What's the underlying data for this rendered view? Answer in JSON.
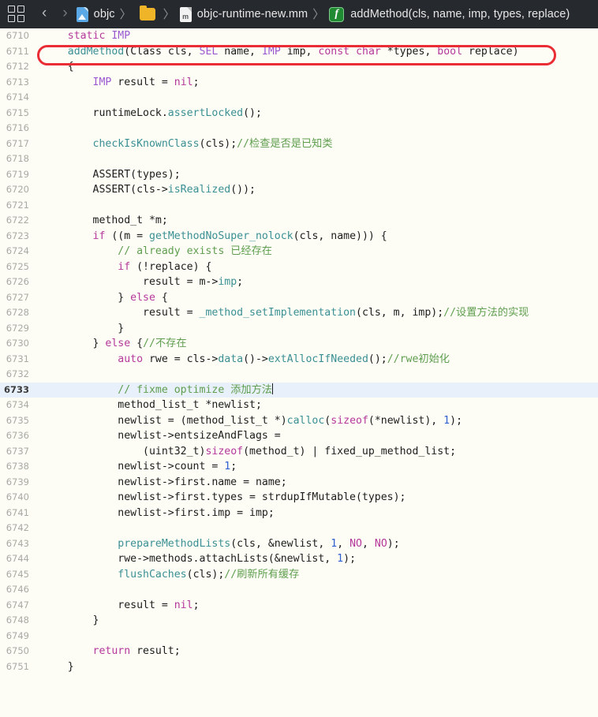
{
  "breadcrumb": {
    "grid_icon": "grid-tiles-icon",
    "back_label": "‹",
    "forward_label": "›",
    "separator": "〉",
    "items": [
      {
        "icon": "xcode-project-icon",
        "label": "objc"
      },
      {
        "icon": "folder-icon",
        "label": ""
      },
      {
        "icon": "objc-source-file-icon",
        "icon_text": "m",
        "label": "objc-runtime-new.mm"
      },
      {
        "icon": "function-symbol-icon",
        "icon_text": "f",
        "label": "addMethod(cls, name, imp, types, replace)"
      }
    ]
  },
  "editor": {
    "current_line": 6733,
    "annotated_line": 6711,
    "annotation_color": "#ea2d35",
    "current_line_highlight": "#e8f0fb",
    "background": "#fdfdf6",
    "lines": [
      {
        "n": 6710,
        "tokens": [
          {
            "t": "    ",
            "c": "pl"
          },
          {
            "t": "static",
            "c": "kw"
          },
          {
            "t": " ",
            "c": "pl"
          },
          {
            "t": "IMP",
            "c": "typ"
          }
        ]
      },
      {
        "n": 6711,
        "tokens": [
          {
            "t": "    ",
            "c": "pl"
          },
          {
            "t": "addMethod",
            "c": "fn"
          },
          {
            "t": "(",
            "c": "pl"
          },
          {
            "t": "Class",
            "c": "pl"
          },
          {
            "t": " cls, ",
            "c": "pl"
          },
          {
            "t": "SEL",
            "c": "typ"
          },
          {
            "t": " name, ",
            "c": "pl"
          },
          {
            "t": "IMP",
            "c": "typ"
          },
          {
            "t": " imp, ",
            "c": "pl"
          },
          {
            "t": "const",
            "c": "kw"
          },
          {
            "t": " ",
            "c": "pl"
          },
          {
            "t": "char",
            "c": "kw"
          },
          {
            "t": " *types, ",
            "c": "pl"
          },
          {
            "t": "bool",
            "c": "kw"
          },
          {
            "t": " replace)",
            "c": "pl"
          }
        ]
      },
      {
        "n": 6712,
        "tokens": [
          {
            "t": "    {",
            "c": "pl"
          }
        ]
      },
      {
        "n": 6713,
        "tokens": [
          {
            "t": "        ",
            "c": "pl"
          },
          {
            "t": "IMP",
            "c": "typ"
          },
          {
            "t": " result = ",
            "c": "pl"
          },
          {
            "t": "nil",
            "c": "kw"
          },
          {
            "t": ";",
            "c": "pl"
          }
        ]
      },
      {
        "n": 6714,
        "tokens": []
      },
      {
        "n": 6715,
        "tokens": [
          {
            "t": "        runtimeLock.",
            "c": "pl"
          },
          {
            "t": "assertLocked",
            "c": "fn"
          },
          {
            "t": "();",
            "c": "pl"
          }
        ]
      },
      {
        "n": 6716,
        "tokens": []
      },
      {
        "n": 6717,
        "tokens": [
          {
            "t": "        ",
            "c": "pl"
          },
          {
            "t": "checkIsKnownClass",
            "c": "fn"
          },
          {
            "t": "(cls);",
            "c": "pl"
          },
          {
            "t": "//检查是否是已知类",
            "c": "cm"
          }
        ]
      },
      {
        "n": 6718,
        "tokens": []
      },
      {
        "n": 6719,
        "tokens": [
          {
            "t": "        ",
            "c": "pl"
          },
          {
            "t": "ASSERT",
            "c": "pl"
          },
          {
            "t": "(types);",
            "c": "pl"
          }
        ]
      },
      {
        "n": 6720,
        "tokens": [
          {
            "t": "        ASSERT(cls->",
            "c": "pl"
          },
          {
            "t": "isRealized",
            "c": "fn"
          },
          {
            "t": "());",
            "c": "pl"
          }
        ]
      },
      {
        "n": 6721,
        "tokens": []
      },
      {
        "n": 6722,
        "tokens": [
          {
            "t": "        method_t *m;",
            "c": "pl"
          }
        ]
      },
      {
        "n": 6723,
        "tokens": [
          {
            "t": "        ",
            "c": "pl"
          },
          {
            "t": "if",
            "c": "kw"
          },
          {
            "t": " ((m = ",
            "c": "pl"
          },
          {
            "t": "getMethodNoSuper_nolock",
            "c": "fn"
          },
          {
            "t": "(cls, name))) {",
            "c": "pl"
          }
        ]
      },
      {
        "n": 6724,
        "tokens": [
          {
            "t": "            ",
            "c": "pl"
          },
          {
            "t": "// already exists 已经存在",
            "c": "cm"
          }
        ]
      },
      {
        "n": 6725,
        "tokens": [
          {
            "t": "            ",
            "c": "pl"
          },
          {
            "t": "if",
            "c": "kw"
          },
          {
            "t": " (!replace) {",
            "c": "pl"
          }
        ]
      },
      {
        "n": 6726,
        "tokens": [
          {
            "t": "                result = m->",
            "c": "pl"
          },
          {
            "t": "imp",
            "c": "fn"
          },
          {
            "t": ";",
            "c": "pl"
          }
        ]
      },
      {
        "n": 6727,
        "tokens": [
          {
            "t": "            } ",
            "c": "pl"
          },
          {
            "t": "else",
            "c": "kw"
          },
          {
            "t": " {",
            "c": "pl"
          }
        ]
      },
      {
        "n": 6728,
        "tokens": [
          {
            "t": "                result = ",
            "c": "pl"
          },
          {
            "t": "_method_setImplementation",
            "c": "fn"
          },
          {
            "t": "(cls, m, imp);",
            "c": "pl"
          },
          {
            "t": "//设置方法的实现",
            "c": "cm"
          }
        ]
      },
      {
        "n": 6729,
        "tokens": [
          {
            "t": "            }",
            "c": "pl"
          }
        ]
      },
      {
        "n": 6730,
        "tokens": [
          {
            "t": "        } ",
            "c": "pl"
          },
          {
            "t": "else",
            "c": "kw"
          },
          {
            "t": " {",
            "c": "pl"
          },
          {
            "t": "//不存在",
            "c": "cm"
          }
        ]
      },
      {
        "n": 6731,
        "tokens": [
          {
            "t": "            ",
            "c": "pl"
          },
          {
            "t": "auto",
            "c": "kw"
          },
          {
            "t": " rwe = cls->",
            "c": "pl"
          },
          {
            "t": "data",
            "c": "fn"
          },
          {
            "t": "()->",
            "c": "pl"
          },
          {
            "t": "extAllocIfNeeded",
            "c": "fn"
          },
          {
            "t": "();",
            "c": "pl"
          },
          {
            "t": "//rwe初始化",
            "c": "cm"
          }
        ]
      },
      {
        "n": 6732,
        "tokens": []
      },
      {
        "n": 6733,
        "tokens": [
          {
            "t": "            ",
            "c": "pl"
          },
          {
            "t": "// fixme optimize 添加方法",
            "c": "cm"
          }
        ],
        "caret": true
      },
      {
        "n": 6734,
        "tokens": [
          {
            "t": "            method_list_t *newlist;",
            "c": "pl"
          }
        ]
      },
      {
        "n": 6735,
        "tokens": [
          {
            "t": "            newlist = (method_list_t *)",
            "c": "pl"
          },
          {
            "t": "calloc",
            "c": "fn"
          },
          {
            "t": "(",
            "c": "pl"
          },
          {
            "t": "sizeof",
            "c": "kw"
          },
          {
            "t": "(*newlist), ",
            "c": "pl"
          },
          {
            "t": "1",
            "c": "num"
          },
          {
            "t": ");",
            "c": "pl"
          }
        ]
      },
      {
        "n": 6736,
        "tokens": [
          {
            "t": "            newlist->entsizeAndFlags =",
            "c": "pl"
          }
        ]
      },
      {
        "n": 6737,
        "tokens": [
          {
            "t": "                (uint32_t)",
            "c": "pl"
          },
          {
            "t": "sizeof",
            "c": "kw"
          },
          {
            "t": "(method_t) | fixed_up_method_list;",
            "c": "pl"
          }
        ]
      },
      {
        "n": 6738,
        "tokens": [
          {
            "t": "            newlist->count = ",
            "c": "pl"
          },
          {
            "t": "1",
            "c": "num"
          },
          {
            "t": ";",
            "c": "pl"
          }
        ]
      },
      {
        "n": 6739,
        "tokens": [
          {
            "t": "            newlist->first.name = name;",
            "c": "pl"
          }
        ]
      },
      {
        "n": 6740,
        "tokens": [
          {
            "t": "            newlist->first.types = strdupIfMutable(types);",
            "c": "pl"
          }
        ]
      },
      {
        "n": 6741,
        "tokens": [
          {
            "t": "            newlist->first.imp = imp;",
            "c": "pl"
          }
        ]
      },
      {
        "n": 6742,
        "tokens": []
      },
      {
        "n": 6743,
        "tokens": [
          {
            "t": "            ",
            "c": "pl"
          },
          {
            "t": "prepareMethodLists",
            "c": "fn"
          },
          {
            "t": "(cls, &newlist, ",
            "c": "pl"
          },
          {
            "t": "1",
            "c": "num"
          },
          {
            "t": ", ",
            "c": "pl"
          },
          {
            "t": "NO",
            "c": "kw"
          },
          {
            "t": ", ",
            "c": "pl"
          },
          {
            "t": "NO",
            "c": "kw"
          },
          {
            "t": ");",
            "c": "pl"
          }
        ]
      },
      {
        "n": 6744,
        "tokens": [
          {
            "t": "            rwe->methods.attachLists(&newlist, ",
            "c": "pl"
          },
          {
            "t": "1",
            "c": "num"
          },
          {
            "t": ");",
            "c": "pl"
          }
        ]
      },
      {
        "n": 6745,
        "tokens": [
          {
            "t": "            ",
            "c": "pl"
          },
          {
            "t": "flushCaches",
            "c": "fn"
          },
          {
            "t": "(cls);",
            "c": "pl"
          },
          {
            "t": "//刷新所有缓存",
            "c": "cm"
          }
        ]
      },
      {
        "n": 6746,
        "tokens": []
      },
      {
        "n": 6747,
        "tokens": [
          {
            "t": "            result = ",
            "c": "pl"
          },
          {
            "t": "nil",
            "c": "kw"
          },
          {
            "t": ";",
            "c": "pl"
          }
        ]
      },
      {
        "n": 6748,
        "tokens": [
          {
            "t": "        }",
            "c": "pl"
          }
        ]
      },
      {
        "n": 6749,
        "tokens": []
      },
      {
        "n": 6750,
        "tokens": [
          {
            "t": "        ",
            "c": "pl"
          },
          {
            "t": "return",
            "c": "kw"
          },
          {
            "t": " result;",
            "c": "pl"
          }
        ]
      },
      {
        "n": 6751,
        "tokens": [
          {
            "t": "    }",
            "c": "pl"
          }
        ]
      }
    ]
  }
}
